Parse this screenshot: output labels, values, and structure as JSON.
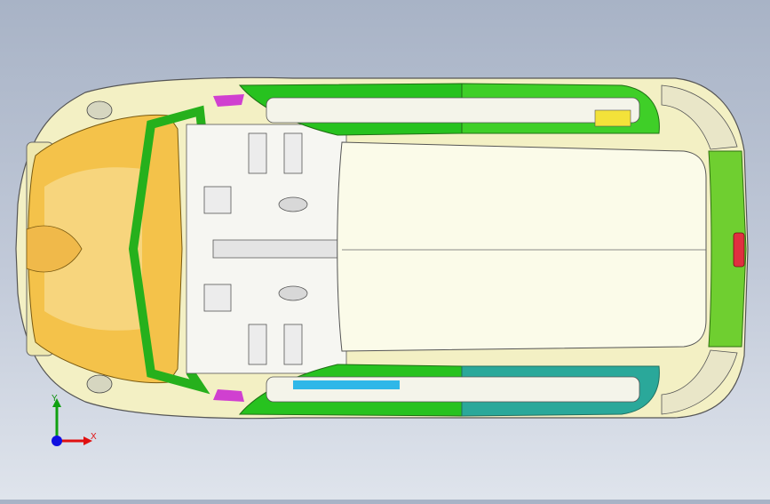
{
  "viewport": {
    "background_top": "#a8b3c6",
    "background_bottom": "#dfe4ec",
    "model": {
      "body_color": "#f3f0c4",
      "roof_color": "#fbfbe9",
      "hood_color": "#f4c24a",
      "door_front_color": "#27c21f",
      "door_rear_color": "#3fcf28",
      "door_rear_bottom_color": "#2aa89a",
      "tail_color": "#6fcf30",
      "lamp_color": "#e03040",
      "accent_magenta": "#d040d0",
      "accent_cyan": "#2fb7e8"
    }
  },
  "triad": {
    "x_label": "X",
    "y_label": "Y",
    "x_color": "#e01010",
    "y_color": "#10a010",
    "z_color": "#1010e0"
  }
}
